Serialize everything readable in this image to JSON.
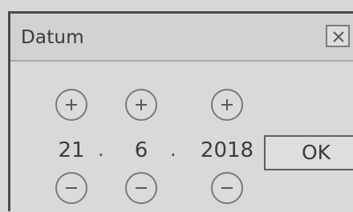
{
  "dialog": {
    "title": "Datum",
    "close_icon": "close-icon",
    "day": {
      "value": "21",
      "increment_icon": "plus-icon",
      "decrement_icon": "minus-icon"
    },
    "month": {
      "value": "6",
      "increment_icon": "plus-icon",
      "decrement_icon": "minus-icon"
    },
    "year": {
      "value": "2018",
      "increment_icon": "plus-icon",
      "decrement_icon": "minus-icon"
    },
    "separator_1": ".",
    "separator_2": ".",
    "ok_label": "OK"
  }
}
